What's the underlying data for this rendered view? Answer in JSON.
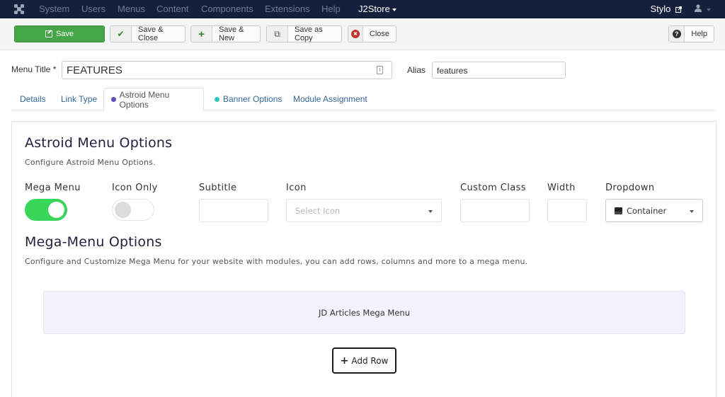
{
  "navbar": {
    "logo_icon": "joomla-logo-icon",
    "menu": [
      "System",
      "Users",
      "Menus",
      "Content",
      "Components",
      "Extensions",
      "Help"
    ],
    "brand": "J2Store",
    "site_link": "Stylo",
    "site_link_icon": "external-link-icon",
    "user_icon": "user-icon"
  },
  "toolbar": {
    "save": "Save",
    "save_close": "Save & Close",
    "save_new": "Save & New",
    "save_copy": "Save as Copy",
    "close": "Close",
    "help": "Help",
    "icons": {
      "save_close": "✔",
      "save_new": "+",
      "save_copy": "⧉",
      "close": "✖",
      "help": "?"
    }
  },
  "form": {
    "menu_title_label": "Menu Title *",
    "menu_title_value": "FEATURES",
    "alias_label": "Alias",
    "alias_value": "features"
  },
  "tabs": [
    {
      "label": "Details"
    },
    {
      "label": "Link Type"
    },
    {
      "label": "Astroid Menu Options",
      "dot_color": "#5b4fb8",
      "active": true
    },
    {
      "label": "Banner Options",
      "dot_color": "#2ec7c0"
    },
    {
      "label": "Module Assignment"
    }
  ],
  "astroid": {
    "title": "Astroid Menu Options",
    "description": "Configure Astroid Menu Options.",
    "fields": {
      "mega_menu": {
        "label": "Mega Menu",
        "value": true
      },
      "icon_only": {
        "label": "Icon Only",
        "value": false
      },
      "subtitle": {
        "label": "Subtitle",
        "value": ""
      },
      "icon": {
        "label": "Icon",
        "placeholder": "Select Icon"
      },
      "custom_class": {
        "label": "Custom Class",
        "value": ""
      },
      "width": {
        "label": "Width",
        "value": ""
      },
      "dropdown": {
        "label": "Dropdown",
        "value": "Container"
      }
    }
  },
  "mega": {
    "title": "Mega-Menu Options",
    "description": "Configure and Customize Mega Menu for your website with modules, you can add rows, columns and more to a mega menu.",
    "row_label": "JD Articles Mega Menu",
    "add_row": "Add Row"
  },
  "colors": {
    "navbar_bg": "#15203c",
    "save_green": "#46a546",
    "toggle_on": "#37d55a",
    "mega_box_bg": "#f3f1fc"
  }
}
